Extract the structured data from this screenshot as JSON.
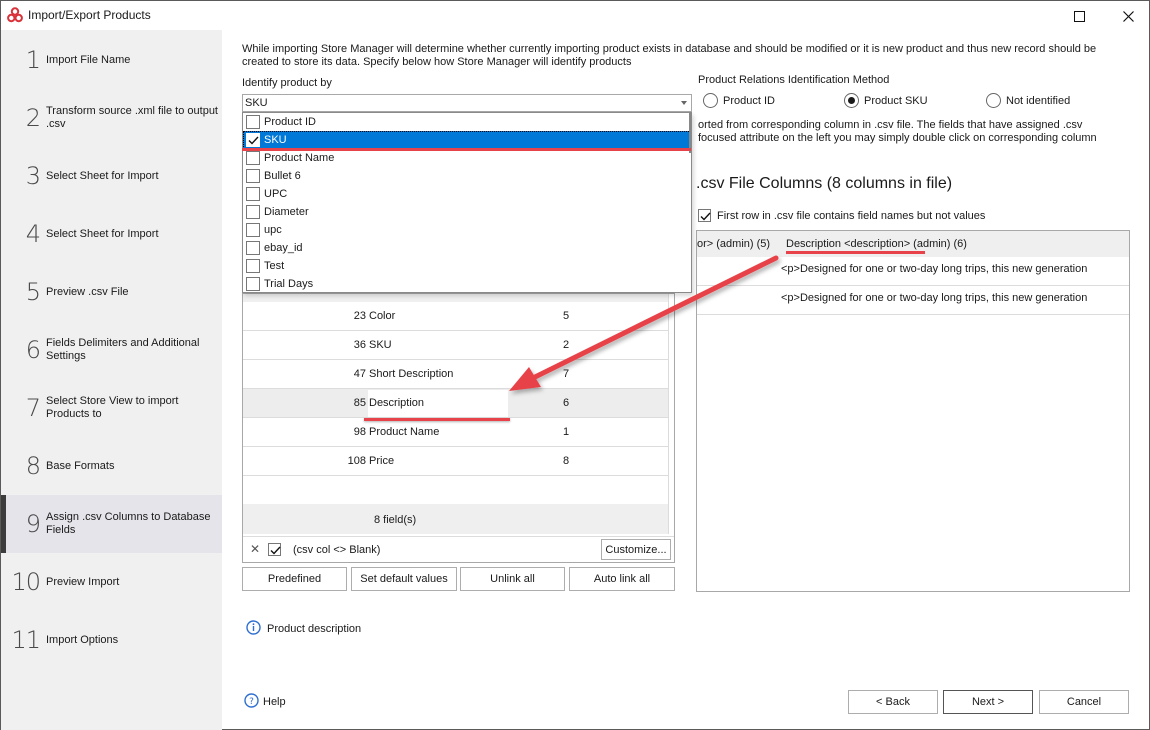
{
  "window": {
    "title": "Import/Export Products",
    "app_icon": "store-manager-logo-icon",
    "controls": [
      "maximize-icon",
      "close-icon"
    ]
  },
  "sidebar": {
    "steps": [
      {
        "num": "1",
        "label": "Import File Name",
        "active": false
      },
      {
        "num": "2",
        "label": "Transform source .xml file to output .csv",
        "active": false
      },
      {
        "num": "3",
        "label": "Select Sheet for Import",
        "active": false
      },
      {
        "num": "4",
        "label": "Select Sheet for Import",
        "active": false
      },
      {
        "num": "5",
        "label": "Preview .csv File",
        "active": false
      },
      {
        "num": "6",
        "label": "Fields Delimiters and Additional Settings",
        "active": false
      },
      {
        "num": "7",
        "label": "Select Store View to import Products to",
        "active": false
      },
      {
        "num": "8",
        "label": "Base Formats",
        "active": false
      },
      {
        "num": "9",
        "label": "Assign .csv Columns to Database Fields",
        "active": true
      },
      {
        "num": "10",
        "label": "Preview Import",
        "active": false
      },
      {
        "num": "11",
        "label": "Import Options",
        "active": false
      }
    ]
  },
  "main": {
    "intro": "While importing Store Manager will determine whether currently importing product exists in database and should be modified or it is new product and thus new record should be created to store its data. Specify below how Store Manager will identify products",
    "identify_label": "Identify product by",
    "identify_value": "SKU",
    "identify_options": [
      {
        "label": "Product ID",
        "checked": false,
        "selected": false
      },
      {
        "label": "SKU",
        "checked": true,
        "selected": true
      },
      {
        "label": "Product Name",
        "checked": false,
        "selected": false
      },
      {
        "label": "Bullet 6",
        "checked": false,
        "selected": false
      },
      {
        "label": "UPC",
        "checked": false,
        "selected": false
      },
      {
        "label": "Diameter",
        "checked": false,
        "selected": false
      },
      {
        "label": "upc",
        "checked": false,
        "selected": false
      },
      {
        "label": "ebay_id",
        "checked": false,
        "selected": false
      },
      {
        "label": "Test",
        "checked": false,
        "selected": false
      },
      {
        "label": "Trial Days",
        "checked": false,
        "selected": false
      }
    ],
    "relations": {
      "label": "Product Relations Identification Method",
      "options": [
        {
          "label": "Product ID",
          "selected": false
        },
        {
          "label": "Product SKU",
          "selected": true
        },
        {
          "label": "Not identified",
          "selected": false
        }
      ]
    },
    "assign_hint_line1": "orted from corresponding column in .csv file. The fields that have assigned .csv",
    "assign_hint_line2": "focused attribute on the left you may simply double click on corresponding column",
    "mapping": {
      "rows": [
        {
          "id": "23",
          "field": "Color",
          "column": "5",
          "highlighted": false
        },
        {
          "id": "36",
          "field": "SKU",
          "column": "2",
          "highlighted": false
        },
        {
          "id": "47",
          "field": "Short Description",
          "column": "7",
          "highlighted": false
        },
        {
          "id": "85",
          "field": "Description",
          "column": "6",
          "highlighted": true
        },
        {
          "id": "98",
          "field": "Product Name",
          "column": "1",
          "highlighted": false
        },
        {
          "id": "108",
          "field": "Price",
          "column": "8",
          "highlighted": false
        }
      ],
      "footer": "8 field(s)",
      "filter_text": "(csv col <> Blank)",
      "filter_checked": true,
      "customize_label": "Customize..."
    },
    "buttons": {
      "predefined": "Predefined",
      "set_default": "Set default values",
      "unlink_all": "Unlink all",
      "auto_link_all": "Auto link all"
    },
    "csv": {
      "title": ".csv File Columns (8 columns in file)",
      "first_row_label": "First row in .csv file contains field names but not values",
      "first_row_checked": true,
      "headers": [
        {
          "label": "or> (admin) (5)"
        },
        {
          "label": "Description <description> (admin) (6)"
        }
      ],
      "rows": [
        "<p>Designed for one or two-day long trips, this new generation",
        "<p>Designed for one or two-day long trips, this new generation"
      ]
    },
    "info_text": "Product description",
    "annotation_color": "#e8434a"
  },
  "footer": {
    "help_label": "Help",
    "back_label": "< Back",
    "next_label": "Next >",
    "cancel_label": "Cancel"
  }
}
